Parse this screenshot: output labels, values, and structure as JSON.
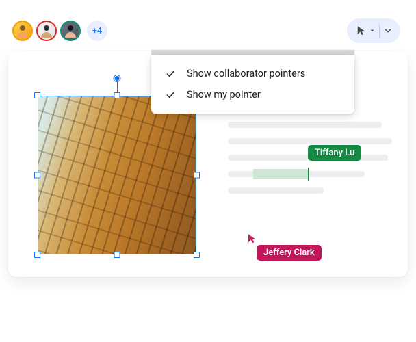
{
  "avatars": {
    "more_label": "+4"
  },
  "menu": {
    "item1": "Show collaborator pointers",
    "item2": "Show my pointer"
  },
  "collaborators": {
    "tiffany": {
      "name": "Tiffany Lu",
      "color": "#168a44"
    },
    "jeffery": {
      "name": "Jeffery Clark",
      "color": "#c2185b"
    }
  }
}
